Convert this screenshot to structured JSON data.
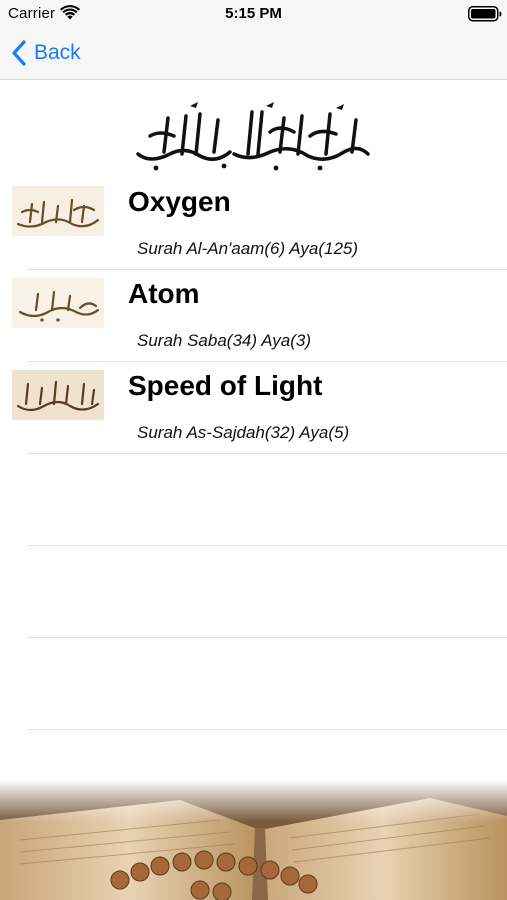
{
  "status_bar": {
    "carrier": "Carrier",
    "time": "5:15 PM",
    "icons": [
      "wifi-icon",
      "battery-icon"
    ]
  },
  "nav": {
    "back_label": "Back",
    "accent_color": "#1a7cf5",
    "icon": "chevron-left-icon"
  },
  "header": {
    "image": "basmala-calligraphy"
  },
  "rows": [
    {
      "title": "Oxygen",
      "subtitle": "Surah Al-An'aam(6) Aya(125)",
      "thumbnail": "surah-al-anaam-calligraphy"
    },
    {
      "title": "Atom",
      "subtitle": "Surah Saba(34) Aya(3)",
      "thumbnail": "surah-saba-calligraphy"
    },
    {
      "title": "Speed of Light",
      "subtitle": "Surah As-Sajdah(32) Aya(5)",
      "thumbnail": "surah-as-sajdah-calligraphy"
    }
  ],
  "footer": {
    "image": "quran-and-prayer-beads"
  }
}
